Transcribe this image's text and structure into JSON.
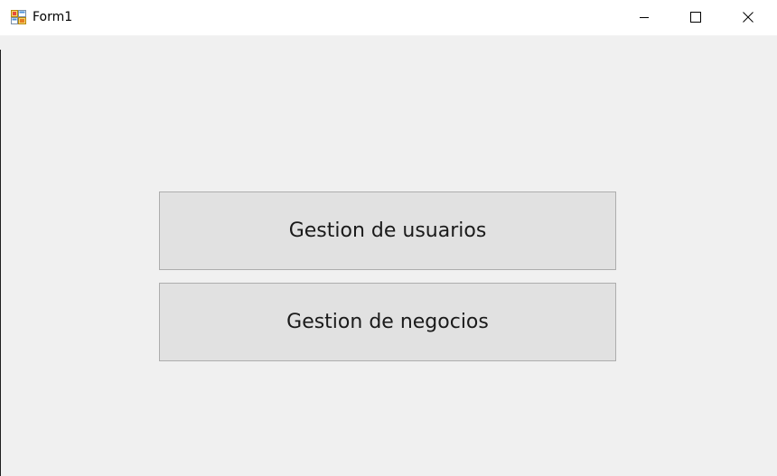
{
  "window": {
    "title": "Form1",
    "icon": "winforms-app-icon",
    "controls": {
      "minimize": "minimize-icon",
      "maximize": "maximize-icon",
      "close": "close-icon"
    }
  },
  "main": {
    "buttons": [
      {
        "label": "Gestion de usuarios"
      },
      {
        "label": "Gestion de negocios"
      }
    ]
  },
  "colors": {
    "form_background": "#f0f0f0",
    "button_face": "#e1e1e1",
    "button_border": "#adadad",
    "titlebar": "#ffffff"
  }
}
